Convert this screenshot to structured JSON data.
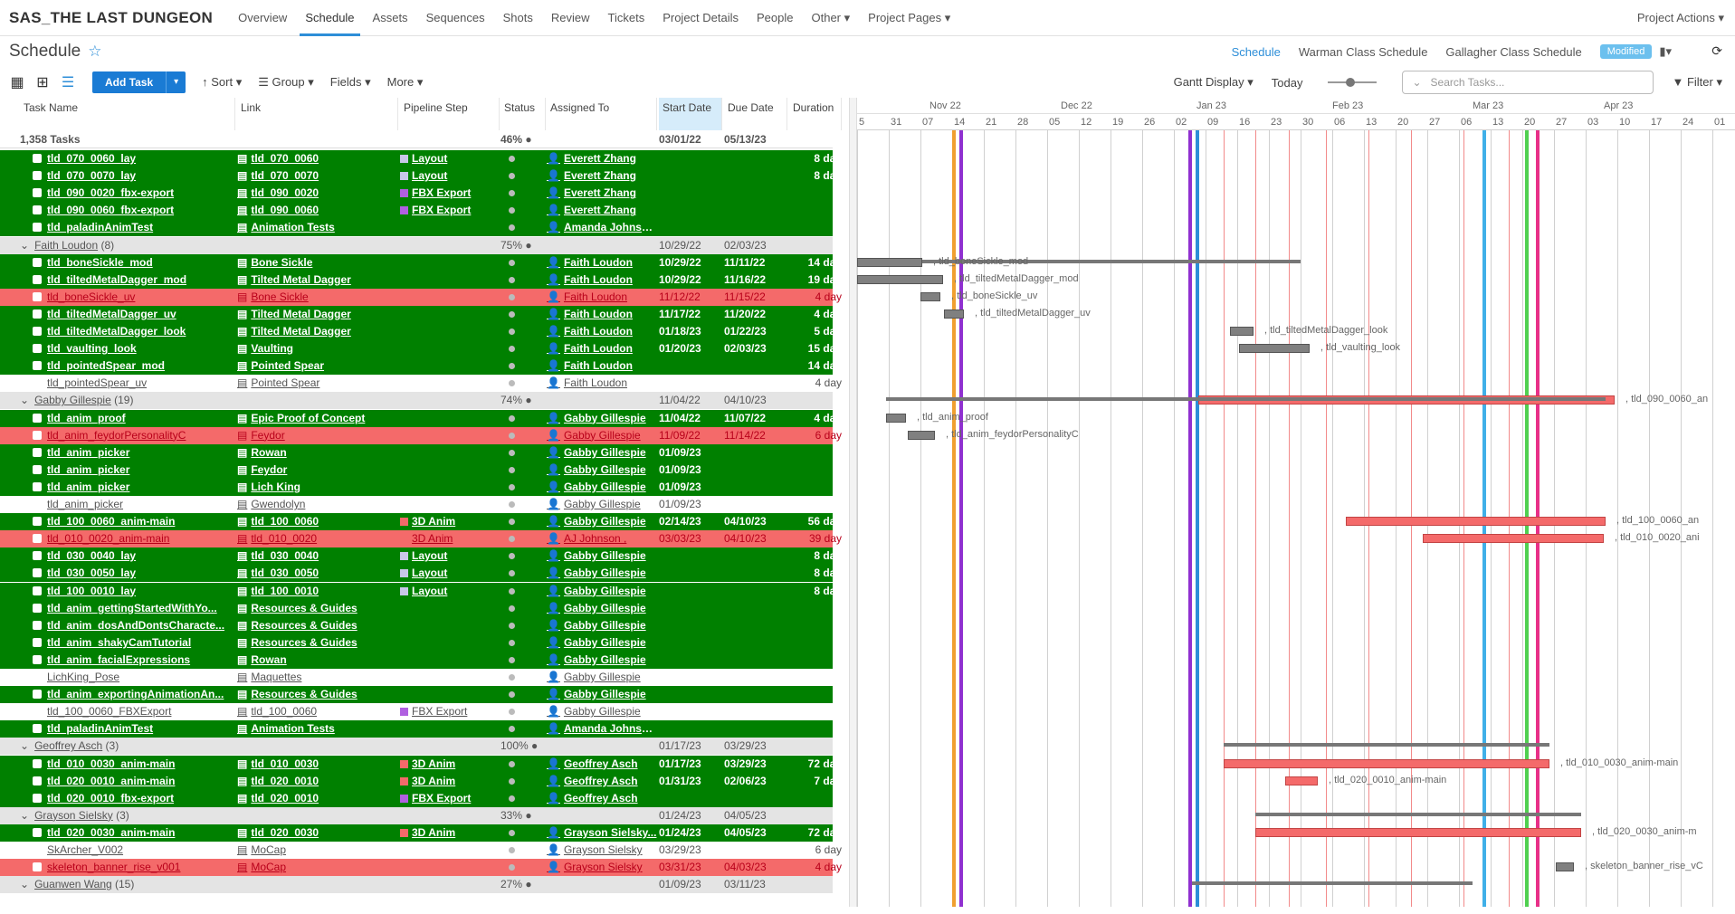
{
  "project": "SAS_THE LAST DUNGEON",
  "nav": [
    "Overview",
    "Schedule",
    "Assets",
    "Sequences",
    "Shots",
    "Review",
    "Tickets",
    "Project Details",
    "People",
    "Other ▾",
    "Project Pages ▾"
  ],
  "project_actions": "Project Actions ▾",
  "page_title": "Schedule",
  "views": [
    "Schedule",
    "Warman Class Schedule",
    "Gallagher Class Schedule"
  ],
  "modified": "Modified",
  "toolbar": {
    "add": "Add Task",
    "sort": "Sort",
    "group": "Group",
    "fields": "Fields",
    "more": "More",
    "gantt": "Gantt Display",
    "today": "Today",
    "search_placeholder": "Search Tasks...",
    "filter": "Filter"
  },
  "columns": [
    "Task Name",
    "Link",
    "Pipeline Step",
    "Status",
    "Assigned To",
    "Start Date",
    "Due Date",
    "Duration"
  ],
  "summary": {
    "count": "1,358 Tasks",
    "pct": "46%",
    "start": "03/01/22",
    "due": "05/13/23"
  },
  "rows": [
    {
      "t": "g",
      "n": "tld_070_0060_lay",
      "l": "tld_070_0060",
      "s": "Layout",
      "sc": "#c8c8e8",
      "a": "Everett Zhang",
      "st": "",
      "du": "",
      "d": "8 day"
    },
    {
      "t": "g",
      "n": "tld_070_0070_lay",
      "l": "tld_070_0070",
      "s": "Layout",
      "sc": "#c8c8e8",
      "a": "Everett Zhang",
      "st": "",
      "du": "",
      "d": "8 day"
    },
    {
      "t": "g",
      "n": "tld_090_0020_fbx-export",
      "l": "tld_090_0020",
      "s": "FBX Export",
      "sc": "#b060e0",
      "a": "Everett Zhang",
      "st": "",
      "du": "",
      "d": ""
    },
    {
      "t": "g",
      "n": "tld_090_0060_fbx-export",
      "l": "tld_090_0060",
      "s": "FBX Export",
      "sc": "#b060e0",
      "a": "Everett Zhang",
      "st": "",
      "du": "",
      "d": ""
    },
    {
      "t": "g",
      "n": "tld_paladinAnimTest",
      "l": "Animation Tests",
      "s": "",
      "sc": "",
      "a": "Amanda Johnso...",
      "st": "",
      "du": "",
      "d": ""
    },
    {
      "t": "grp",
      "n": "Faith Loudon",
      "c": "(8)",
      "p": "75%",
      "st": "10/29/22",
      "du": "02/03/23"
    },
    {
      "t": "g",
      "n": "tld_boneSickle_mod",
      "l": "Bone Sickle",
      "s": "",
      "sc": "",
      "a": "Faith Loudon",
      "st": "10/29/22",
      "du": "11/11/22",
      "d": "14 day"
    },
    {
      "t": "g",
      "n": "tld_tiltedMetalDagger_mod",
      "l": "Tilted Metal Dagger",
      "s": "",
      "sc": "",
      "a": "Faith Loudon",
      "st": "10/29/22",
      "du": "11/16/22",
      "d": "19 day"
    },
    {
      "t": "r",
      "n": "tld_boneSickle_uv",
      "l": "Bone Sickle",
      "s": "",
      "sc": "",
      "a": "Faith Loudon",
      "st": "11/12/22",
      "du": "11/15/22",
      "d": "4 day"
    },
    {
      "t": "g",
      "n": "tld_tiltedMetalDagger_uv",
      "l": "Tilted Metal Dagger",
      "s": "",
      "sc": "",
      "a": "Faith Loudon",
      "st": "11/17/22",
      "du": "11/20/22",
      "d": "4 day"
    },
    {
      "t": "g",
      "n": "tld_tiltedMetalDagger_look",
      "l": "Tilted Metal Dagger",
      "s": "",
      "sc": "",
      "a": "Faith Loudon",
      "st": "01/18/23",
      "du": "01/22/23",
      "d": "5 day"
    },
    {
      "t": "g",
      "n": "tld_vaulting_look",
      "l": "Vaulting",
      "s": "",
      "sc": "",
      "a": "Faith Loudon",
      "st": "01/20/23",
      "du": "02/03/23",
      "d": "15 day"
    },
    {
      "t": "g",
      "n": "tld_pointedSpear_mod",
      "l": "Pointed Spear",
      "s": "",
      "sc": "",
      "a": "Faith Loudon",
      "st": "",
      "du": "",
      "d": "14 day"
    },
    {
      "t": "w",
      "n": "tld_pointedSpear_uv",
      "l": "Pointed Spear",
      "s": "",
      "sc": "",
      "a": "Faith Loudon",
      "st": "",
      "du": "",
      "d": "4 day"
    },
    {
      "t": "grp",
      "n": "Gabby Gillespie",
      "c": "(19)",
      "p": "74%",
      "st": "11/04/22",
      "du": "04/10/23"
    },
    {
      "t": "g",
      "n": "tld_anim_proof",
      "l": "Epic Proof of Concept",
      "s": "",
      "sc": "",
      "a": "Gabby Gillespie",
      "st": "11/04/22",
      "du": "11/07/22",
      "d": "4 day"
    },
    {
      "t": "r",
      "n": "tld_anim_feydorPersonalityC",
      "l": "Feydor",
      "s": "",
      "sc": "",
      "a": "Gabby Gillespie",
      "st": "11/09/22",
      "du": "11/14/22",
      "d": "6 day"
    },
    {
      "t": "g",
      "n": "tld_anim_picker",
      "l": "Rowan",
      "s": "",
      "sc": "",
      "a": "Gabby Gillespie",
      "st": "01/09/23",
      "du": "",
      "d": ""
    },
    {
      "t": "g",
      "n": "tld_anim_picker",
      "l": "Feydor",
      "s": "",
      "sc": "",
      "a": "Gabby Gillespie",
      "st": "01/09/23",
      "du": "",
      "d": ""
    },
    {
      "t": "g",
      "n": "tld_anim_picker",
      "l": "Lich King",
      "s": "",
      "sc": "",
      "a": "Gabby Gillespie",
      "st": "01/09/23",
      "du": "",
      "d": ""
    },
    {
      "t": "w",
      "n": "tld_anim_picker",
      "l": "Gwendolyn",
      "s": "",
      "sc": "",
      "a": "Gabby Gillespie",
      "st": "01/09/23",
      "du": "",
      "d": ""
    },
    {
      "t": "g",
      "n": "tld_100_0060_anim-main",
      "l": "tld_100_0060",
      "s": "3D Anim",
      "sc": "#f46a6a",
      "a": "Gabby Gillespie",
      "st": "02/14/23",
      "du": "04/10/23",
      "d": "56 day"
    },
    {
      "t": "r",
      "n": "tld_010_0020_anim-main",
      "l": "tld_010_0020",
      "s": "3D Anim",
      "sc": "#f46a6a",
      "a": "AJ Johnson ,",
      "st": "03/03/23",
      "du": "04/10/23",
      "d": "39 day"
    },
    {
      "t": "g",
      "n": "tld_030_0040_lay",
      "l": "tld_030_0040",
      "s": "Layout",
      "sc": "#c8c8e8",
      "a": "Gabby Gillespie",
      "st": "",
      "du": "",
      "d": "8 day"
    },
    {
      "t": "g",
      "n": "tld_030_0050_lay",
      "l": "tld_030_0050",
      "s": "Layout",
      "sc": "#c8c8e8",
      "a": "Gabby Gillespie",
      "st": "",
      "du": "",
      "d": "8 day"
    },
    {
      "t": "g",
      "n": "tld_100_0010_lay",
      "l": "tld_100_0010",
      "s": "Layout",
      "sc": "#c8c8e8",
      "a": "Gabby Gillespie",
      "st": "",
      "du": "",
      "d": "8 day"
    },
    {
      "t": "g",
      "n": "tld_anim_gettingStartedWithYo...",
      "l": "Resources & Guides",
      "s": "",
      "sc": "",
      "a": "Gabby Gillespie",
      "st": "",
      "du": "",
      "d": ""
    },
    {
      "t": "g",
      "n": "tld_anim_dosAndDontsCharacte...",
      "l": "Resources & Guides",
      "s": "",
      "sc": "",
      "a": "Gabby Gillespie",
      "st": "",
      "du": "",
      "d": ""
    },
    {
      "t": "g",
      "n": "tld_anim_shakyCamTutorial",
      "l": "Resources & Guides",
      "s": "",
      "sc": "",
      "a": "Gabby Gillespie",
      "st": "",
      "du": "",
      "d": ""
    },
    {
      "t": "g",
      "n": "tld_anim_facialExpressions",
      "l": "Rowan",
      "s": "",
      "sc": "",
      "a": "Gabby Gillespie",
      "st": "",
      "du": "",
      "d": ""
    },
    {
      "t": "w",
      "n": "LichKing_Pose",
      "l": "Maquettes",
      "s": "",
      "sc": "",
      "a": "Gabby Gillespie",
      "st": "",
      "du": "",
      "d": ""
    },
    {
      "t": "g",
      "n": "tld_anim_exportingAnimationAn...",
      "l": "Resources & Guides",
      "s": "",
      "sc": "",
      "a": "Gabby Gillespie",
      "st": "",
      "du": "",
      "d": ""
    },
    {
      "t": "w",
      "n": "tld_100_0060_FBXExport",
      "l": "tld_100_0060",
      "s": "FBX Export",
      "sc": "#b060e0",
      "a": "Gabby Gillespie",
      "st": "",
      "du": "",
      "d": ""
    },
    {
      "t": "g",
      "n": "tld_paladinAnimTest",
      "l": "Animation Tests",
      "s": "",
      "sc": "",
      "a": "Amanda Johnso...",
      "st": "",
      "du": "",
      "d": ""
    },
    {
      "t": "grp",
      "n": "Geoffrey Asch",
      "c": "(3)",
      "p": "100%",
      "st": "01/17/23",
      "du": "03/29/23"
    },
    {
      "t": "g",
      "n": "tld_010_0030_anim-main",
      "l": "tld_010_0030",
      "s": "3D Anim",
      "sc": "#f46a6a",
      "a": "Geoffrey Asch",
      "st": "01/17/23",
      "du": "03/29/23",
      "d": "72 day"
    },
    {
      "t": "g",
      "n": "tld_020_0010_anim-main",
      "l": "tld_020_0010",
      "s": "3D Anim",
      "sc": "#f46a6a",
      "a": "Geoffrey Asch",
      "st": "01/31/23",
      "du": "02/06/23",
      "d": "7 day"
    },
    {
      "t": "g",
      "n": "tld_020_0010_fbx-export",
      "l": "tld_020_0010",
      "s": "FBX Export",
      "sc": "#b060e0",
      "a": "Geoffrey Asch",
      "st": "",
      "du": "",
      "d": ""
    },
    {
      "t": "grp",
      "n": "Grayson Sielsky",
      "c": "(3)",
      "p": "33%",
      "st": "01/24/23",
      "du": "04/05/23"
    },
    {
      "t": "g",
      "n": "tld_020_0030_anim-main",
      "l": "tld_020_0030",
      "s": "3D Anim",
      "sc": "#f46a6a",
      "a": "Grayson Sielsky...",
      "st": "01/24/23",
      "du": "04/05/23",
      "d": "72 day"
    },
    {
      "t": "w",
      "n": "SkArcher_V002",
      "l": "MoCap",
      "s": "",
      "sc": "",
      "a": "Grayson Sielsky",
      "st": "03/29/23",
      "du": "",
      "d": "6 day"
    },
    {
      "t": "r",
      "n": "skeleton_banner_rise_v001",
      "l": "MoCap",
      "s": "",
      "sc": "",
      "a": "Grayson Sielsky",
      "st": "03/31/23",
      "du": "04/03/23",
      "d": "4 day"
    },
    {
      "t": "grp",
      "n": "Guanwen Wang",
      "c": "(15)",
      "p": "27%",
      "st": "01/09/23",
      "du": "03/11/23"
    }
  ],
  "gantt_months": [
    "Nov 22",
    "Dec 22",
    "Jan 23",
    "Feb 23",
    "Mar 23",
    "Apr 23"
  ],
  "gantt_days": [
    "5",
    "31",
    "07",
    "14",
    "21",
    "28",
    "05",
    "12",
    "19",
    "26",
    "02",
    "09",
    "16",
    "23",
    "30",
    "06",
    "13",
    "20",
    "27",
    "06",
    "13",
    "20",
    "27",
    "03",
    "10",
    "17",
    "24",
    "01"
  ],
  "gantt_labels": [
    ", tld_090_0060_an",
    ", tld_boneSickle_mod",
    ", tld_tiltedMetalDagger_mod",
    ", tld_boneSickle_uv",
    ", tld_tiltedMetalDagger_uv",
    ", tld_tiltedMetalDagger_look",
    ", tld_vaulting_look",
    ", tld_anim_proof",
    ", tld_anim_feydorPersonalityC",
    ", tld_100_0060_an",
    ", tld_010_0020_ani",
    ", tld_010_0030_anim-main",
    ", tld_020_0010_anim-main",
    ", tld_020_0030_anim-m",
    ", skeleton_banner_rise_vC"
  ],
  "colors": {
    "green": "#008000",
    "red": "#f46a6a",
    "accent": "#2d8ed8"
  }
}
